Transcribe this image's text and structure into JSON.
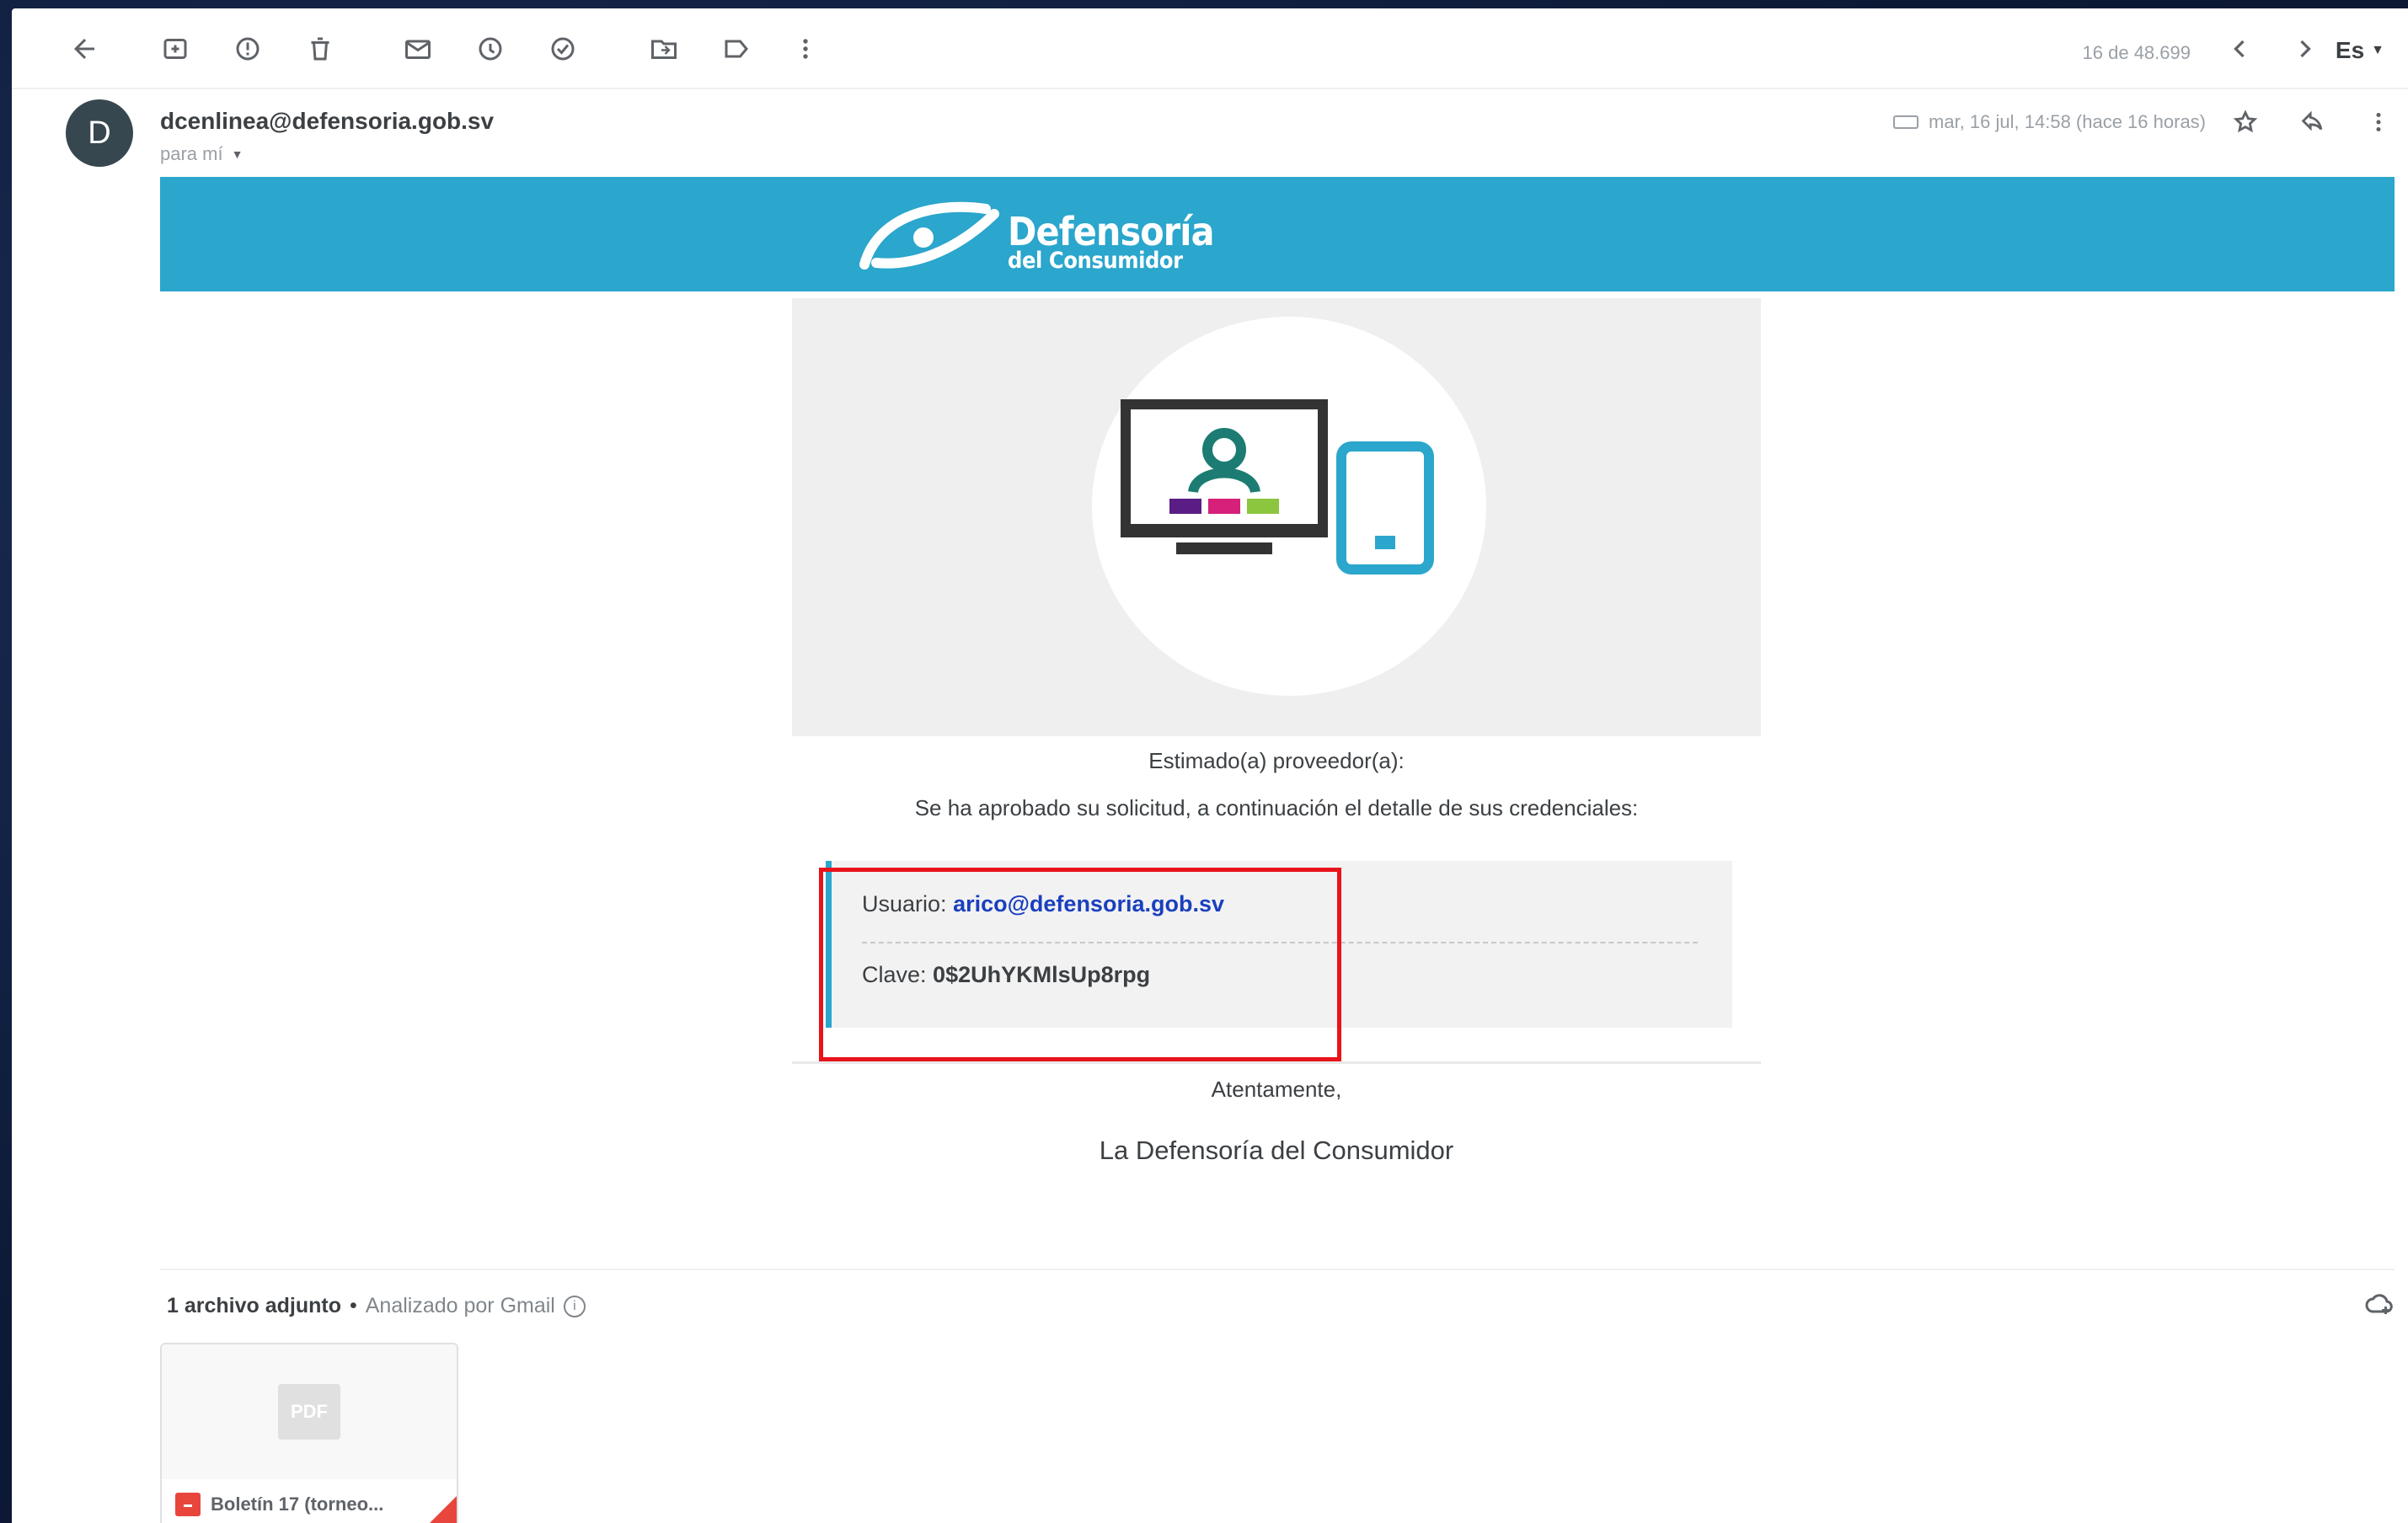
{
  "toolbar": {
    "pager": "16 de 48.699",
    "language": "Es"
  },
  "header": {
    "avatar_letter": "D",
    "sender": "dcenlinea@defensoria.gob.sv",
    "recipient": "para mí",
    "date": "mar, 16 jul, 14:58 (hace 16 horas)"
  },
  "banner": {
    "title": "Defensoría",
    "subtitle": "del Consumidor",
    "color": "#2ba6cc"
  },
  "body": {
    "greeting": "Estimado(a) proveedor(a):",
    "message": "Se ha aprobado su solicitud, a continuación el detalle de sus credenciales:",
    "user_label": "Usuario:",
    "user_value": "arico@defensoria.gob.sv",
    "password_label": "Clave:",
    "password_value": "0$2UhYKMlsUp8rpg",
    "closing": "Atentamente,",
    "signature": "La Defensoría del Consumidor"
  },
  "attachments": {
    "count_label": "1 archivo adjunto",
    "separator": "•",
    "scan_label": "Analizado por Gmail",
    "items": [
      {
        "name": "Boletín 17 (torneo...",
        "thumb_label": "PDF"
      }
    ]
  },
  "colors": {
    "highlight": "#e8141b",
    "link": "#1a3fbf",
    "accent": "#2ba6cc"
  }
}
